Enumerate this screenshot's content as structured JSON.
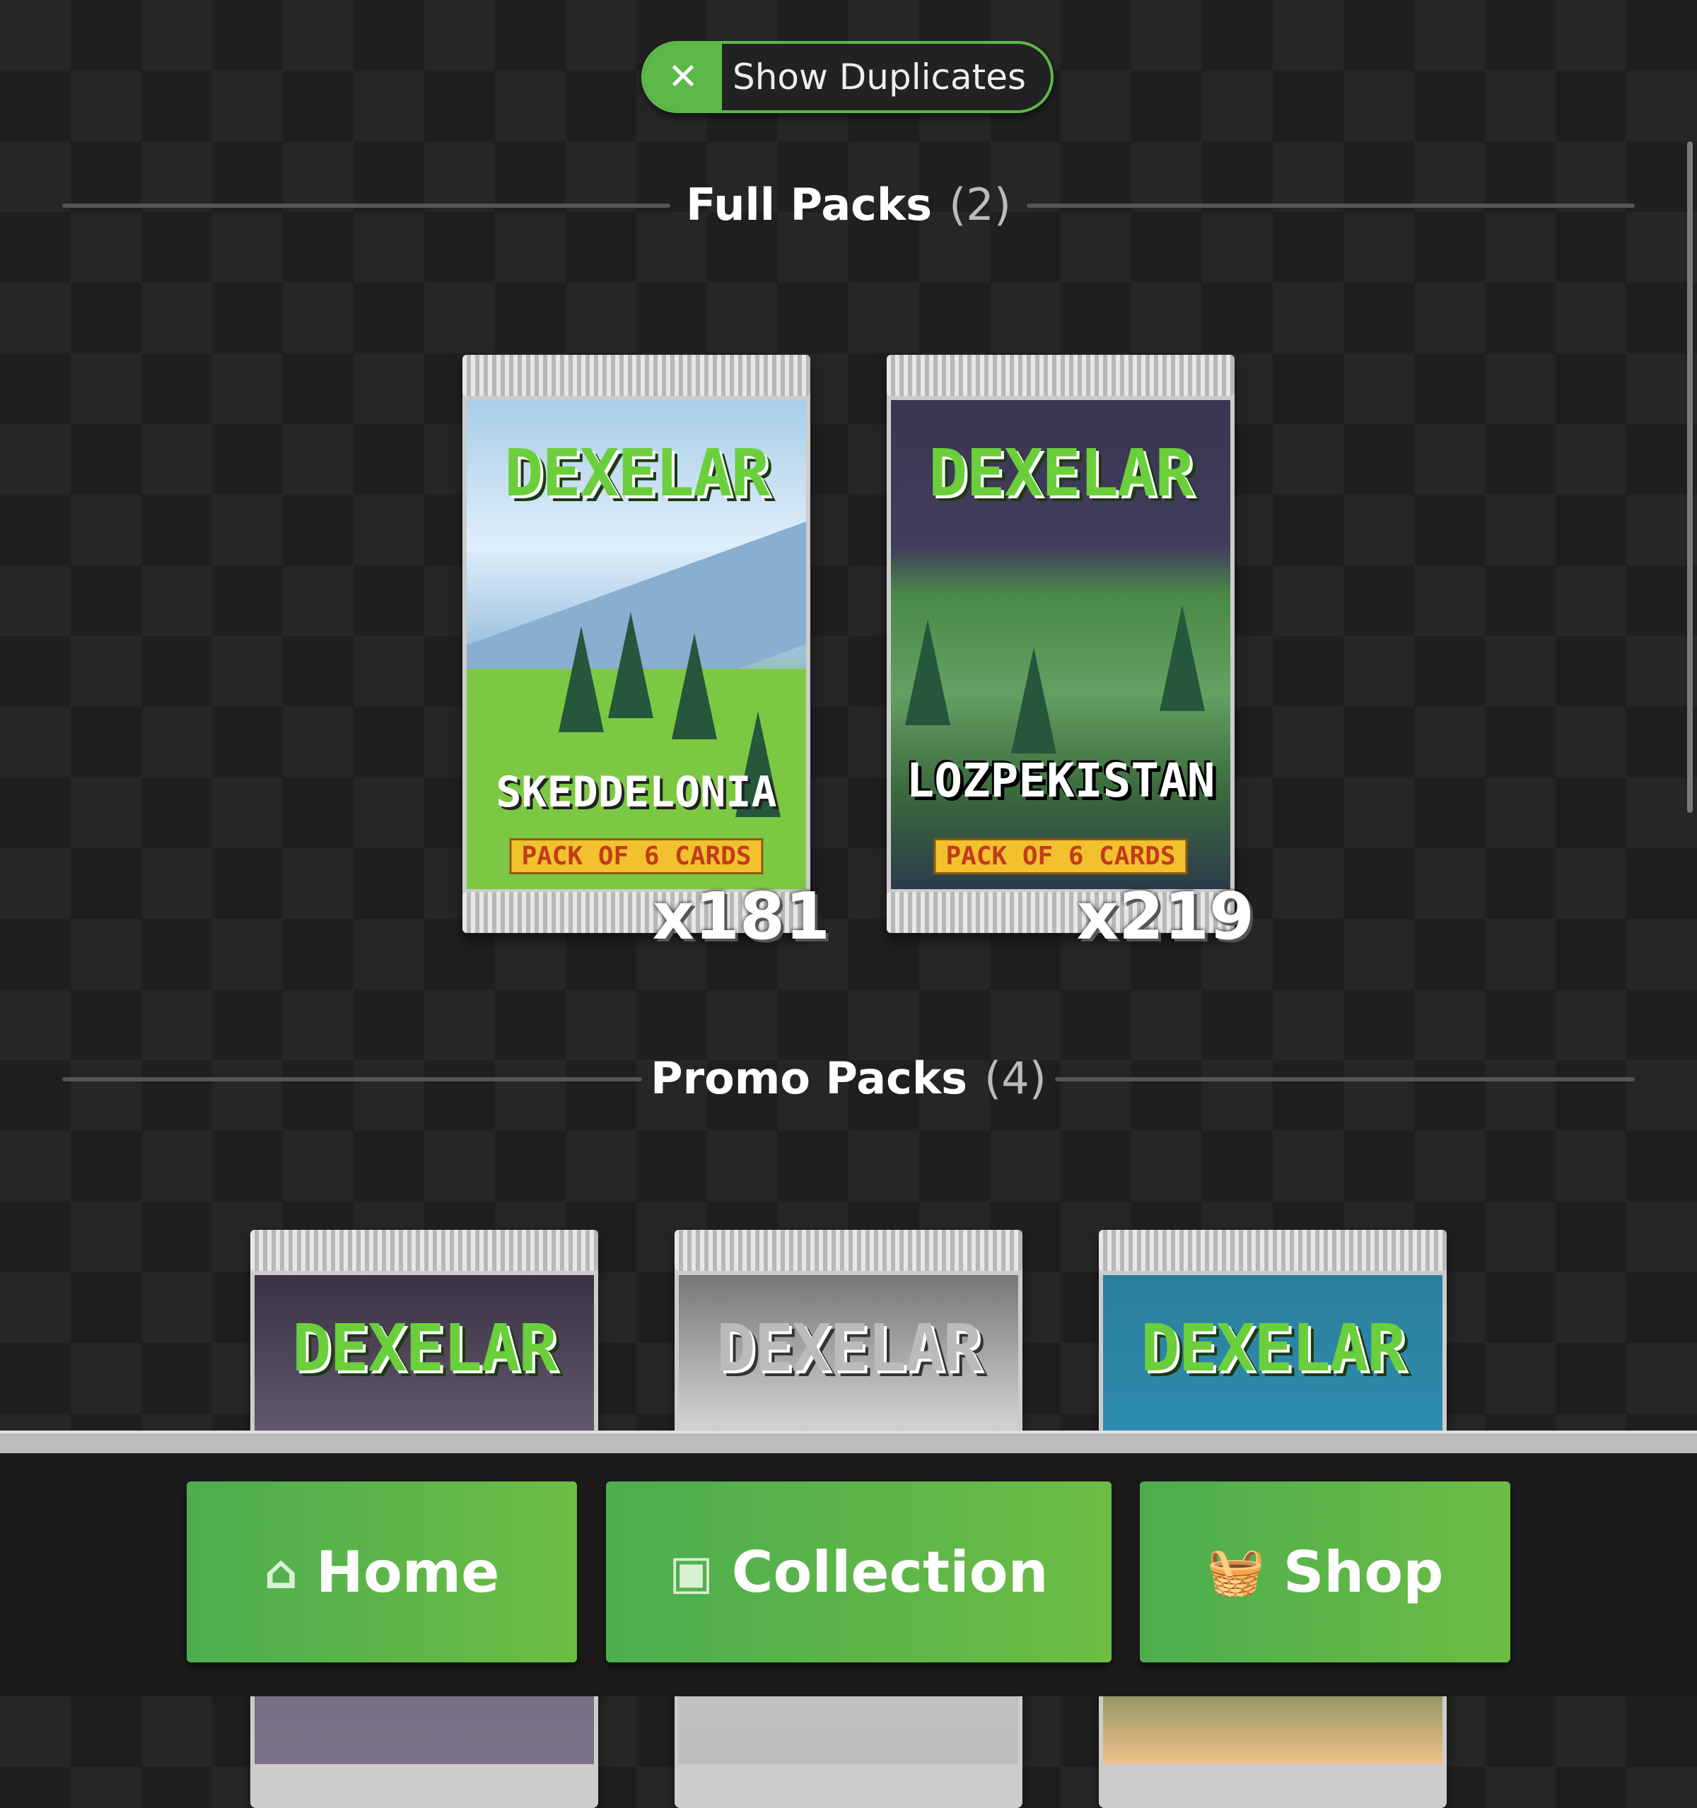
{
  "toggle": {
    "label": "Show Duplicates",
    "icon": "close-icon",
    "state": "off"
  },
  "sections": {
    "full": {
      "title": "Full Packs",
      "count": "(2)"
    },
    "promo": {
      "title": "Promo Packs",
      "count": "(4)"
    }
  },
  "packs": {
    "full": [
      {
        "brand": "DEXELAR",
        "region": "SKEDDELONIA",
        "tag": "PACK OF 6 CARDS",
        "qty": "x181"
      },
      {
        "brand": "DEXELAR",
        "region": "LOZPEKISTAN",
        "tag": "PACK OF 6 CARDS",
        "qty": "x219"
      }
    ],
    "promo": [
      {
        "brand": "DEXELAR"
      },
      {
        "brand": "DEXELAR"
      },
      {
        "brand": "DEXELAR"
      }
    ]
  },
  "nav": {
    "home": {
      "label": "Home",
      "icon": "home-icon"
    },
    "collection": {
      "label": "Collection",
      "icon": "archive-box-icon"
    },
    "shop": {
      "label": "Shop",
      "icon": "shopping-basket-icon"
    }
  },
  "colors": {
    "accent": "#5cb848",
    "background": "#262626",
    "button": "#4cad4e"
  }
}
